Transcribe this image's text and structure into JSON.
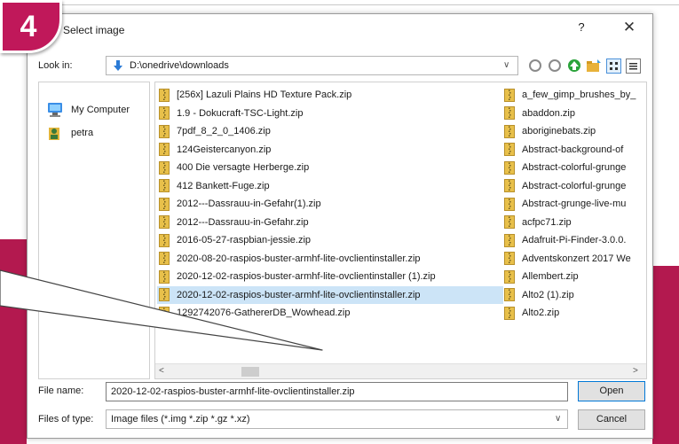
{
  "badge": {
    "number": "4"
  },
  "dialog": {
    "title": "Select image",
    "help_glyph": "?",
    "close_glyph": "✕"
  },
  "lookin": {
    "label": "Look in:",
    "value": "D:\\onedrive\\downloads",
    "arrow": "∨"
  },
  "sidebar": {
    "items": [
      {
        "label": "My Computer",
        "icon": "computer-icon"
      },
      {
        "label": "petra",
        "icon": "user-icon"
      }
    ]
  },
  "files": {
    "col1": [
      "[256x] Lazuli Plains HD Texture Pack.zip",
      "1.9 - Dokucraft-TSC-Light.zip",
      "7pdf_8_2_0_1406.zip",
      "124Geistercanyon.zip",
      "400 Die versagte Herberge.zip",
      "412 Bankett-Fuge.zip",
      "2012---Dassrauu-in-Gefahr(1).zip",
      "2012---Dassrauu-in-Gefahr.zip",
      "2016-05-27-raspbian-jessie.zip",
      "2020-08-20-raspios-buster-armhf-lite-ovclientinstaller.zip",
      "2020-12-02-raspios-buster-armhf-lite-ovclientinstaller (1).zip",
      "2020-12-02-raspios-buster-armhf-lite-ovclientinstaller.zip",
      "1292742076-GathererDB_Wowhead.zip"
    ],
    "col2": [
      "a_few_gimp_brushes_by_",
      "abaddon.zip",
      "aboriginebats.zip",
      "Abstract-background-of",
      "Abstract-colorful-grunge",
      "Abstract-colorful-grunge",
      "Abstract-grunge-live-mu",
      "acfpc71.zip",
      "Adafruit-Pi-Finder-3.0.0.",
      "Adventskonzert 2017 We",
      "Allembert.zip",
      "Alto2 (1).zip",
      "Alto2.zip"
    ],
    "selected_index": 11
  },
  "scroll": {
    "left": "<",
    "right": ">"
  },
  "filename": {
    "label": "File name:",
    "value": "2020-12-02-raspios-buster-armhf-lite-ovclientinstaller.zip",
    "open_label": "Open"
  },
  "filetype": {
    "label": "Files of type:",
    "value": "Image files (*.img *.zip *.gz *.xz)",
    "arrow": "∨",
    "cancel_label": "Cancel"
  },
  "colors": {
    "accent": "#b3194f",
    "badge": "#c0185a",
    "selection": "#cce4f7",
    "zip_icon": "#e8c04a"
  }
}
